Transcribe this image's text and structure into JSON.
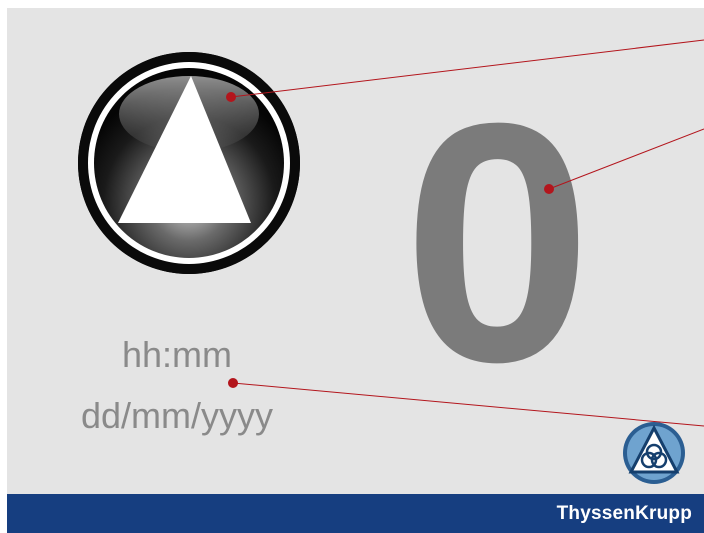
{
  "display": {
    "direction_icon": "up-arrow-icon",
    "floor_number": "0",
    "time_placeholder": "hh:mm",
    "date_placeholder": "dd/mm/yyyy"
  },
  "footer": {
    "brand": "ThyssenKrupp",
    "logo_icon": "thyssenkrupp-logo-icon"
  },
  "colors": {
    "panel_background": "#e4e4e4",
    "footer_background": "#163e80",
    "floor_digit": "#7b7b7b",
    "placeholder_text": "#8a8a8a",
    "callout_line": "#b3151c",
    "logo_blue": "#1f5d9a"
  }
}
